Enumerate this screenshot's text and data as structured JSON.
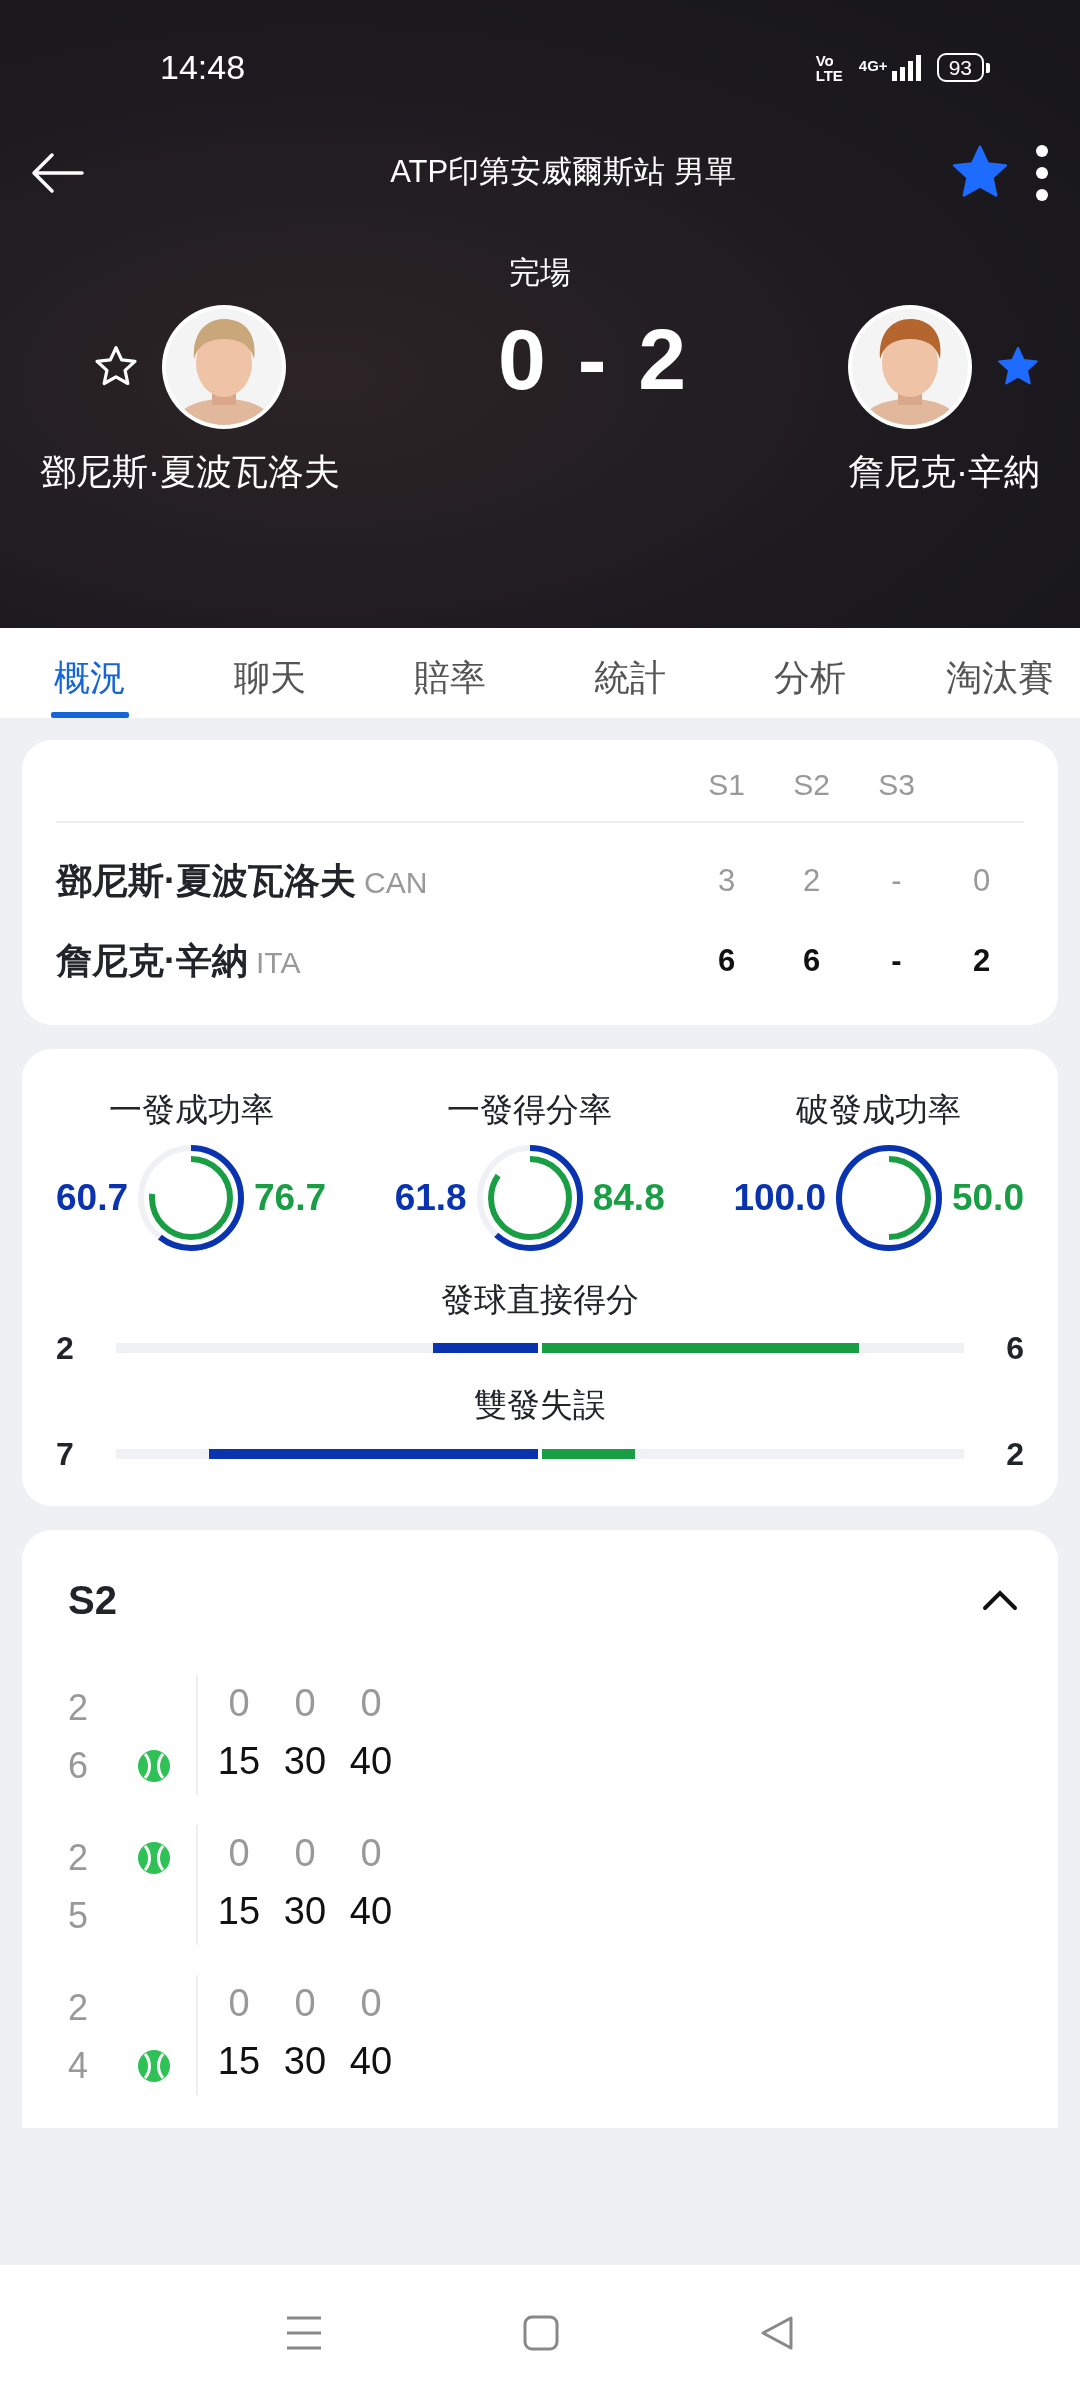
{
  "status_bar": {
    "time": "14:48",
    "volte_top": "Vo",
    "volte_bottom": "LTE",
    "network": "4G+",
    "battery": "93"
  },
  "header": {
    "title": "ATP印第安威爾斯站 男單",
    "favorite": true,
    "status": "完場",
    "home_score": "0",
    "separator": "-",
    "away_score": "2"
  },
  "players": [
    {
      "name": "鄧尼斯·夏波瓦洛夫",
      "favorite": false
    },
    {
      "name": "詹尼克·辛納",
      "favorite": true
    }
  ],
  "tabs": [
    {
      "label": "概況",
      "selected": true
    },
    {
      "label": "聊天",
      "selected": false
    },
    {
      "label": "賠率",
      "selected": false
    },
    {
      "label": "統計",
      "selected": false
    },
    {
      "label": "分析",
      "selected": false
    },
    {
      "label": "淘汰賽",
      "selected": false
    }
  ],
  "scoreboard": {
    "columns": [
      "S1",
      "S2",
      "S3"
    ],
    "rows": [
      {
        "name": "鄧尼斯·夏波瓦洛夫",
        "country": "CAN",
        "sets": [
          "3",
          "2",
          "-"
        ],
        "total": "0",
        "winner": false
      },
      {
        "name": "詹尼克·辛納",
        "country": "ITA",
        "sets": [
          "6",
          "6",
          "-"
        ],
        "total": "2",
        "winner": true
      }
    ]
  },
  "stats": {
    "rings": [
      {
        "label": "一發成功率",
        "home": {
          "value": "60.7",
          "level": 0.607
        },
        "away": {
          "value": "76.7",
          "level": 0.767
        }
      },
      {
        "label": "一發得分率",
        "home": {
          "value": "61.8",
          "level": 0.618
        },
        "away": {
          "value": "84.8",
          "level": 0.848
        }
      },
      {
        "label": "破發成功率",
        "home": {
          "value": "100.0",
          "level": 1.0
        },
        "away": {
          "value": "50.0",
          "level": 0.5
        }
      }
    ],
    "bars": [
      {
        "label": "發球直接得分",
        "home": {
          "value": "2",
          "level": 0.25
        },
        "away": {
          "value": "6",
          "level": 0.75
        }
      },
      {
        "label": "雙發失誤",
        "home": {
          "value": "7",
          "level": 0.78
        },
        "away": {
          "value": "2",
          "level": 0.22
        }
      }
    ]
  },
  "set_detail": {
    "title": "S2",
    "expanded": true,
    "games": [
      {
        "home": {
          "games": "2",
          "serving": false,
          "points": [
            "0",
            "0",
            "0"
          ]
        },
        "away": {
          "games": "6",
          "serving": true,
          "points": [
            "15",
            "30",
            "40"
          ]
        }
      },
      {
        "home": {
          "games": "2",
          "serving": true,
          "points": [
            "0",
            "0",
            "0"
          ]
        },
        "away": {
          "games": "5",
          "serving": false,
          "points": [
            "15",
            "30",
            "40"
          ]
        }
      },
      {
        "home": {
          "games": "2",
          "serving": false,
          "points": [
            "0",
            "0",
            "0"
          ]
        },
        "away": {
          "games": "4",
          "serving": true,
          "points": [
            "15",
            "30",
            "40"
          ]
        }
      }
    ]
  }
}
